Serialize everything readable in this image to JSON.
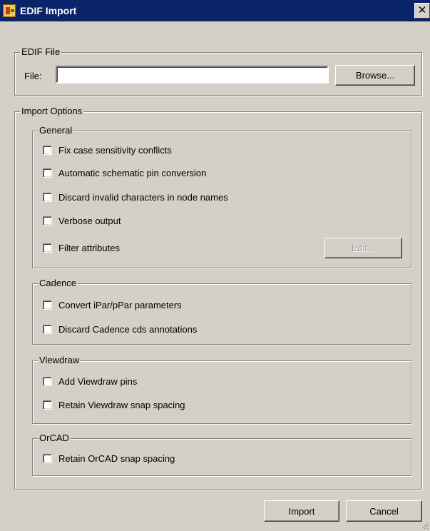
{
  "window": {
    "title": "EDIF Import",
    "close_glyph": "✕"
  },
  "edif_file": {
    "legend": "EDIF File",
    "file_label": "File:",
    "file_value": "",
    "browse_label": "Browse..."
  },
  "import_options": {
    "legend": "Import Options",
    "general": {
      "legend": "General",
      "options": [
        {
          "label": "Fix case sensitivity conflicts",
          "checked": false
        },
        {
          "label": "Automatic schematic pin conversion",
          "checked": false
        },
        {
          "label": "Discard invalid characters in node names",
          "checked": false
        },
        {
          "label": "Verbose output",
          "checked": false
        },
        {
          "label": "Filter attributes",
          "checked": false
        }
      ],
      "edit_label": "Edit..."
    },
    "cadence": {
      "legend": "Cadence",
      "options": [
        {
          "label": "Convert iPar/pPar parameters",
          "checked": false
        },
        {
          "label": "Discard Cadence cds annotations",
          "checked": false
        }
      ]
    },
    "viewdraw": {
      "legend": "Viewdraw",
      "options": [
        {
          "label": "Add Viewdraw pins",
          "checked": false
        },
        {
          "label": "Retain Viewdraw snap spacing",
          "checked": false
        }
      ]
    },
    "orcad": {
      "legend": "OrCAD",
      "options": [
        {
          "label": "Retain OrCAD snap spacing",
          "checked": false
        }
      ]
    }
  },
  "footer": {
    "import_label": "Import",
    "cancel_label": "Cancel"
  }
}
